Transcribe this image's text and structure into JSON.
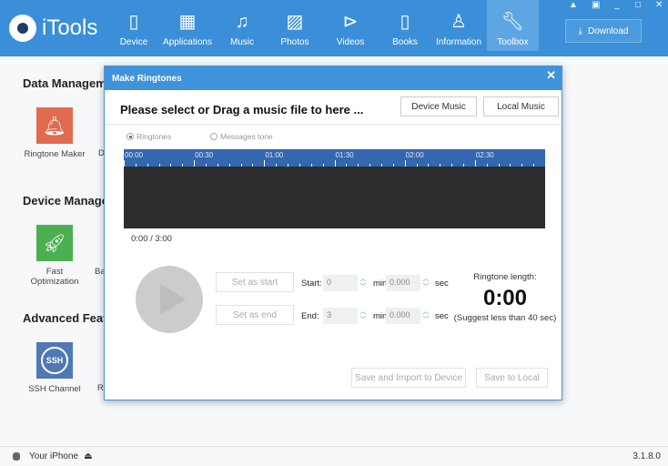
{
  "app": {
    "name": "iTools",
    "version": "3.1.8.0"
  },
  "nav": [
    {
      "label": "Device",
      "icon": "phone-icon",
      "active": false
    },
    {
      "label": "Applications",
      "icon": "grid-icon",
      "active": false
    },
    {
      "label": "Music",
      "icon": "music-note-icon",
      "active": false
    },
    {
      "label": "Photos",
      "icon": "image-icon",
      "active": false
    },
    {
      "label": "Videos",
      "icon": "play-circle-icon",
      "active": false
    },
    {
      "label": "Books",
      "icon": "book-icon",
      "active": false
    },
    {
      "label": "Information",
      "icon": "person-icon",
      "active": false
    },
    {
      "label": "Toolbox",
      "icon": "wrench-icon",
      "active": true
    }
  ],
  "download_label": "Download",
  "sections": {
    "data": "Data Managem",
    "device": "Device Manage",
    "advanced": "Advanced Featu"
  },
  "tools": {
    "ringtone": "Ringtone Maker",
    "fast_1": "Fast",
    "fast_2": "Optimization",
    "ssh": "SSH Channel",
    "ssh_icon_text": "SSH",
    "frag_d": "D",
    "frag_ba": "Ba",
    "frag_r": "R"
  },
  "status": {
    "device": "Your iPhone"
  },
  "modal": {
    "title": "Make Ringtones",
    "prompt": "Please select or Drag a music file to here ...",
    "device_music": "Device Music",
    "local_music": "Local Music",
    "radio_ringtones": "Ringtones",
    "radio_messages": "Messages tone",
    "ruler": [
      "00:00",
      "00:30",
      "01:00",
      "01:30",
      "02:00",
      "02:30"
    ],
    "time": "0:00 / 3:00",
    "set_start": "Set as start",
    "set_end": "Set as end",
    "start_label": "Start:",
    "end_label": "End:",
    "start_min": "0",
    "start_sec": "0.000",
    "end_min": "3",
    "end_sec": "0.000",
    "min": "min",
    "sec": "sec",
    "length_label": "Ringtone length:",
    "length": "0:00",
    "suggest": "(Suggest less than 40 sec)",
    "save_import": "Save and Import to Device",
    "save_local": "Save to Local"
  }
}
